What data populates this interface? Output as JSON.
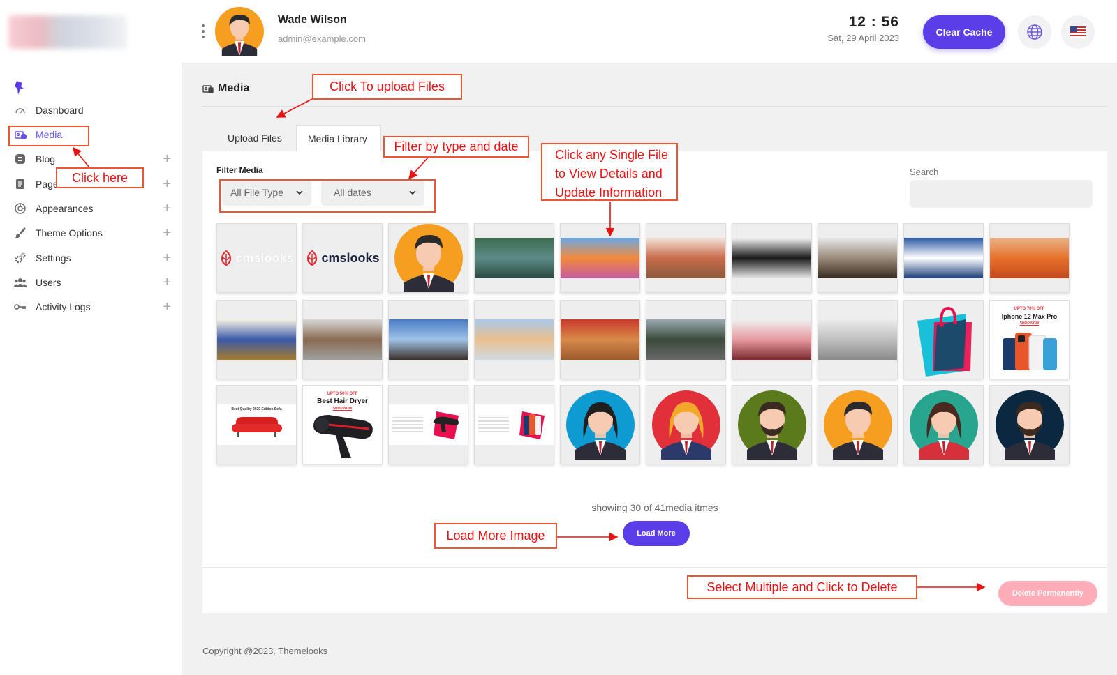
{
  "header": {
    "user_name": "Wade Wilson",
    "user_email": "admin@example.com",
    "time": "12 : 56",
    "date": "Sat, 29 April 2023",
    "clear_cache_label": "Clear Cache",
    "icons": [
      "more-vertical-icon",
      "globe-icon",
      "us-flag-icon"
    ]
  },
  "sidebar": {
    "items": [
      {
        "label": "Dashboard",
        "icon": "dashboard-gauge-icon"
      },
      {
        "label": "Media",
        "icon": "media-icon",
        "active": true
      },
      {
        "label": "Blog",
        "icon": "blog-icon"
      },
      {
        "label": "Pages",
        "icon": "pages-icon"
      },
      {
        "label": "Appearances",
        "icon": "appearance-icon"
      },
      {
        "label": "Theme Options",
        "icon": "brush-icon"
      },
      {
        "label": "Settings",
        "icon": "gear-icon"
      },
      {
        "label": "Users",
        "icon": "users-icon"
      },
      {
        "label": "Activity Logs",
        "icon": "key-icon"
      }
    ]
  },
  "main": {
    "title": "Media",
    "tabs": [
      {
        "label": "Upload Files"
      },
      {
        "label": "Media Library",
        "active": true
      }
    ],
    "filter": {
      "label": "Filter Media",
      "type_value": "All File Type",
      "date_value": "All dates"
    },
    "search": {
      "label": "Search",
      "value": ""
    },
    "thumbnails": [
      "cmslooks-logo-white",
      "cmslooks-logo",
      "avatar-man",
      "hiker-lake",
      "flower-portrait",
      "salad-bowl",
      "imac-desk",
      "chef-cooking",
      "santorini",
      "orange-juice",
      "woman-sitting",
      "woman-rocks",
      "hiker-mountain",
      "jumping-man",
      "tomatoes",
      "cyclist",
      "flowers-wine",
      "laptop-desk",
      "shopping-bag-logo",
      "iphone-banner",
      "sofa-banner",
      "hair-dryer-banner",
      "hair-dryer-small-banner",
      "iphone-small-banner",
      "avatar-woman-blue",
      "avatar-woman-red",
      "avatar-man-beard",
      "avatar-man-orange",
      "avatar-woman-teal",
      "avatar-man-navy"
    ],
    "thumbnail_texts": {
      "cmslooks": "cmslooks",
      "iphone_offer": "UPTO 70% OFF",
      "iphone_title": "Iphone 12 Max Pro",
      "dryer_offer": "UPTO 50% OFF",
      "dryer_title": "Best Hair Dryer",
      "shop_now": "SHOP NOW",
      "sofa_title": "Best Quality 2020 Edition Sofa"
    },
    "count_text": "showing 30 of 41media itmes",
    "load_more_label": "Load More",
    "delete_label": "Delete Permanently"
  },
  "footer": {
    "text": "Copyright @2023. Themelooks"
  },
  "annotations": {
    "upload": "Click To upload Files",
    "click_here": "Click here",
    "filter": "Filter by type and date",
    "single_file": [
      "Click any Single File",
      "to View Details and",
      "Update Information"
    ],
    "load_more": "Load More Image",
    "delete": "Select Multiple and Click to Delete"
  },
  "colors": {
    "accent": "#5b3ee8",
    "annotation": "#ee1111",
    "delete": "#ffadb8"
  }
}
